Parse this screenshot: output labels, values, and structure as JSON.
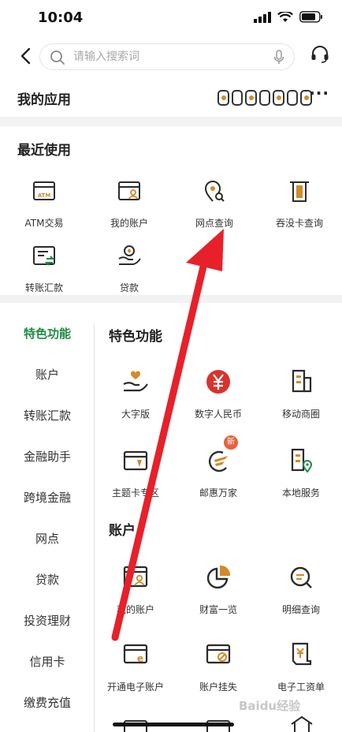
{
  "status_bar": {
    "time": "10:04"
  },
  "search": {
    "placeholder": "请输入搜索词"
  },
  "my_apps": {
    "title": "我的应用",
    "more": "···"
  },
  "recent": {
    "title": "最近使用",
    "items": [
      {
        "label": "ATM交易",
        "icon": "atm-card-icon"
      },
      {
        "label": "我的账户",
        "icon": "account-card-icon"
      },
      {
        "label": "网点查询",
        "icon": "branch-search-icon"
      },
      {
        "label": "吞没卡查询",
        "icon": "card-slot-icon"
      },
      {
        "label": "转账汇款",
        "icon": "transfer-icon"
      },
      {
        "label": "贷款",
        "icon": "loan-hand-icon"
      }
    ]
  },
  "sidenav": {
    "items": [
      {
        "label": "特色功能",
        "active": true
      },
      {
        "label": "账户"
      },
      {
        "label": "转账汇款"
      },
      {
        "label": "金融助手"
      },
      {
        "label": "跨境金融"
      },
      {
        "label": "网点"
      },
      {
        "label": "贷款"
      },
      {
        "label": "投资理财"
      },
      {
        "label": "信用卡"
      },
      {
        "label": "缴费充值"
      }
    ]
  },
  "featured": {
    "title": "特色功能",
    "items": [
      {
        "label": "大字版",
        "icon": "heart-hand-icon"
      },
      {
        "label": "数字人民币",
        "icon": "digital-rmb-icon"
      },
      {
        "label": "移动商圈",
        "icon": "building-icon"
      },
      {
        "label": "主题卡专区",
        "icon": "theme-card-icon"
      },
      {
        "label": "邮惠万家",
        "icon": "wings-icon",
        "badge": "新"
      },
      {
        "label": "本地服务",
        "icon": "local-service-icon"
      }
    ]
  },
  "account": {
    "title": "账户",
    "items": [
      {
        "label": "我的账户",
        "icon": "account-card-icon"
      },
      {
        "label": "财富一览",
        "icon": "pie-chart-icon"
      },
      {
        "label": "明细查询",
        "icon": "detail-search-icon"
      },
      {
        "label": "开通电子账户",
        "icon": "e-account-icon"
      },
      {
        "label": "账户挂失",
        "icon": "lost-card-icon"
      },
      {
        "label": "电子工资单",
        "icon": "payslip-icon"
      }
    ]
  },
  "watermark": "Baidu经验",
  "colors": {
    "accent_green": "#1f8a43",
    "icon_dark": "#2b2b2b",
    "icon_gold": "#d28a2a",
    "badge_red": "#e8613c",
    "arrow_red": "#e8202a"
  }
}
